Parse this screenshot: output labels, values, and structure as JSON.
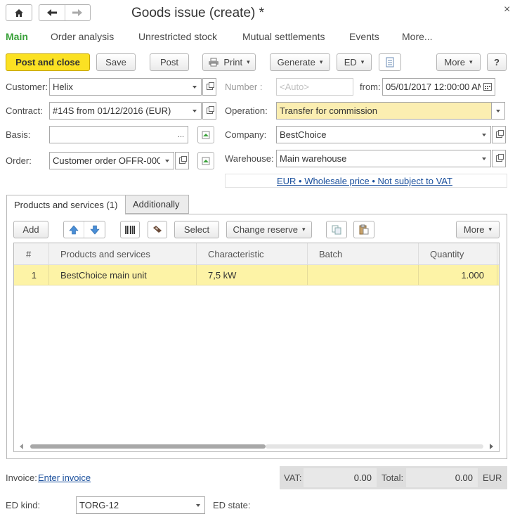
{
  "window": {
    "title": "Goods issue (create) *",
    "close_glyph": "×"
  },
  "nav": {
    "home": "home-icon",
    "back": "back-arrow-icon",
    "forward": "forward-arrow-icon"
  },
  "tabs": [
    "Main",
    "Order analysis",
    "Unrestricted stock",
    "Mutual settlements",
    "Events",
    "More..."
  ],
  "toolbar": {
    "post_and_close": "Post and close",
    "save": "Save",
    "post": "Post",
    "print": "Print",
    "generate": "Generate",
    "ed": "ED",
    "more": "More",
    "help": "?"
  },
  "form": {
    "customer_label": "Customer:",
    "customer_value": "Helix",
    "contract_label": "Contract:",
    "contract_value": "#14S from 01/12/2016 (EUR)",
    "basis_label": "Basis:",
    "basis_value": "",
    "order_label": "Order:",
    "order_value": "Customer order OFFR-000",
    "number_label": "Number :",
    "number_placeholder": "<Auto>",
    "from_label": "from:",
    "date_value": "05/01/2017 12:00:00 AM",
    "operation_label": "Operation:",
    "operation_value": "Transfer for commission",
    "company_label": "Company:",
    "company_value": "BestChoice",
    "warehouse_label": "Warehouse:",
    "warehouse_value": "Main warehouse",
    "pricing_link": "EUR • Wholesale price • Not subject to VAT",
    "ellipsis": "..."
  },
  "inner_tabs": [
    "Products and services (1)",
    "Additionally"
  ],
  "grid_toolbar": {
    "add": "Add",
    "select": "Select",
    "change_reserve": "Change reserve",
    "more": "More"
  },
  "grid": {
    "columns": [
      "#",
      "Products and services",
      "Characteristic",
      "Batch",
      "Quantity"
    ],
    "rows": [
      {
        "num": "1",
        "product": "BestChoice main unit",
        "characteristic": "7,5 kW",
        "batch": "",
        "quantity": "1.000"
      }
    ]
  },
  "footer": {
    "invoice_label": "Invoice:",
    "invoice_link": "Enter invoice",
    "vat_label": "VAT:",
    "vat_value": "0.00",
    "total_label": "Total:",
    "total_value": "0.00",
    "currency": "EUR",
    "ed_kind_label": "ED kind:",
    "ed_kind_value": "TORG-12",
    "ed_state_label": "ED state:"
  },
  "colors": {
    "accent_green": "#3aa13a",
    "primary_button": "#fbe123",
    "highlight_row": "#fdf3a6",
    "highlight_field": "#fbeeb1",
    "link": "#1a4f9c"
  }
}
